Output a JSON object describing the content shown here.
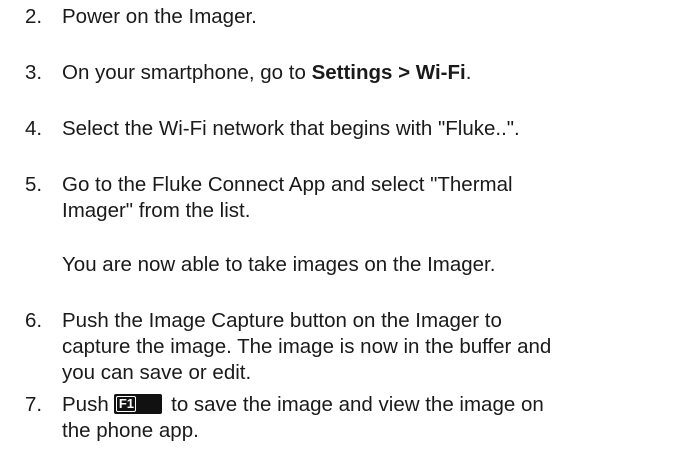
{
  "steps": [
    {
      "number": "2.",
      "text": "Power on the Imager."
    },
    {
      "number": "3.",
      "prefix": "On your smartphone, go to ",
      "bold": "Settings > Wi-Fi",
      "suffix": "."
    },
    {
      "number": "4.",
      "text": "Select the Wi-Fi network that begins with \"Fluke..\"."
    },
    {
      "number": "5.",
      "line1": "Go to the Fluke Connect App and select \"Thermal",
      "line2": "Imager\" from the list."
    },
    {
      "number": "6.",
      "line1": "Push the Image Capture button on the Imager to",
      "line2": "capture the image. The image is now in the buffer and",
      "line3": "you can save or edit."
    },
    {
      "number": "7.",
      "prefix": "Push ",
      "key_label": "F1",
      "suffix": " to save the image and view the image on",
      "line2": "the phone app."
    }
  ],
  "note": "You are now able to take images on the Imager."
}
